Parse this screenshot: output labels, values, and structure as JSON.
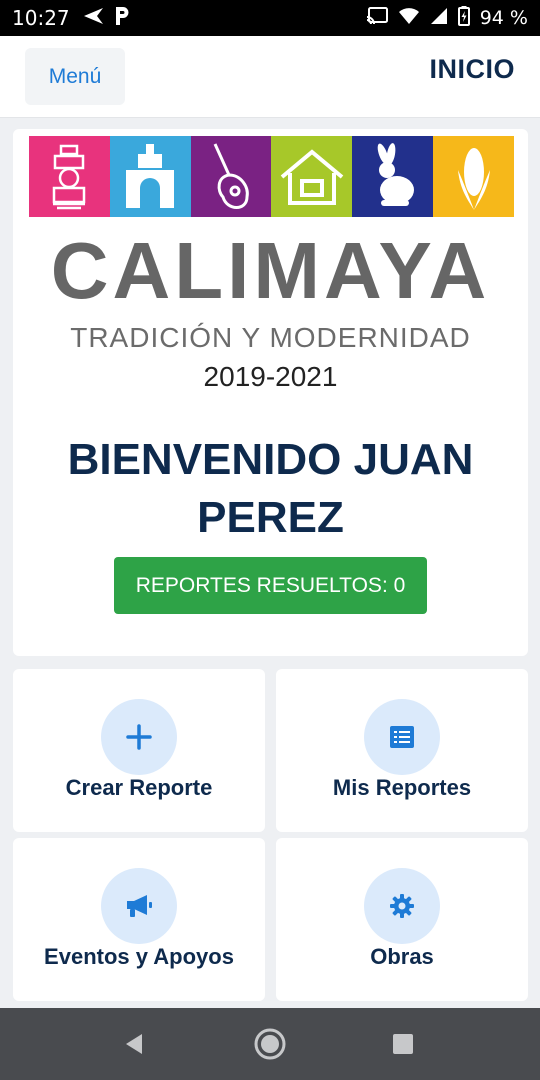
{
  "status_bar": {
    "time": "10:27",
    "battery": "94 %",
    "icons": [
      "navigation-arrow-icon",
      "p-app-icon",
      "cast-icon",
      "wifi-icon",
      "signal-icon",
      "battery-icon"
    ]
  },
  "header": {
    "menu_label": "Menú",
    "title": "INICIO"
  },
  "banner": {
    "tiles": [
      {
        "icon": "train-icon",
        "color": "#e8337d"
      },
      {
        "icon": "arch-building-icon",
        "color": "#3aa8dc"
      },
      {
        "icon": "guitar-icon",
        "color": "#7a2283"
      },
      {
        "icon": "house-icon",
        "color": "#a7c829"
      },
      {
        "icon": "rabbit-icon",
        "color": "#22308c"
      },
      {
        "icon": "corn-icon",
        "color": "#f6b81a"
      }
    ],
    "name": "CALIMAYA",
    "tagline": "TRADICIÓN Y MODERNIDAD",
    "years": "2019-2021"
  },
  "welcome": {
    "line1": "BIENVENIDO JUAN",
    "line2": "PEREZ",
    "resolved_label": "REPORTES RESUELTOS: 0"
  },
  "actions": [
    {
      "label": "Crear Reporte",
      "icon": "plus-icon"
    },
    {
      "label": "Mis Reportes",
      "icon": "list-icon"
    },
    {
      "label": "Eventos y Apoyos",
      "icon": "megaphone-icon"
    },
    {
      "label": "Obras",
      "icon": "gear-icon"
    }
  ],
  "colors": {
    "accent": "#1e7bd6",
    "title": "#0e2a4d",
    "success": "#2ea347",
    "icon_bg": "#dbeafb"
  }
}
